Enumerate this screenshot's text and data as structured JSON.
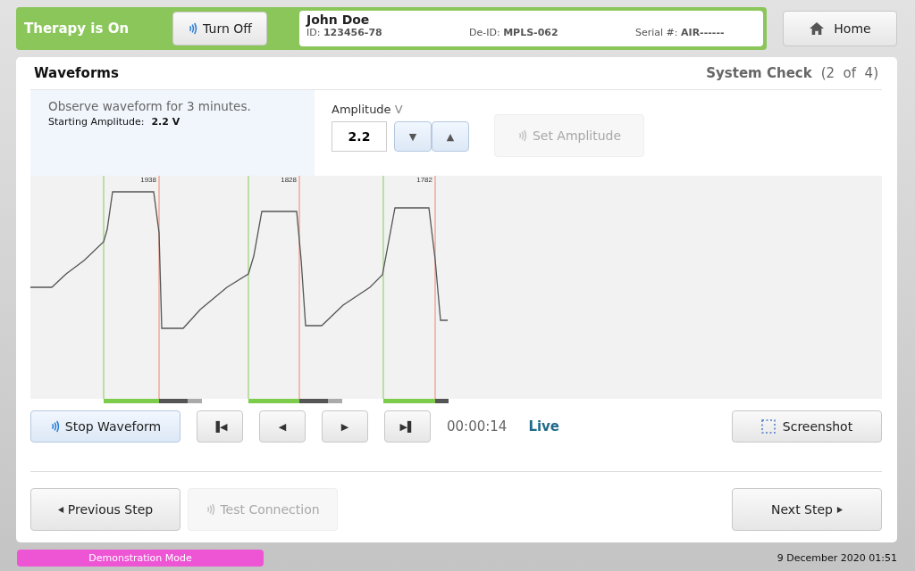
{
  "therapy": {
    "status": "Therapy is On",
    "button": "Turn Off"
  },
  "patient": {
    "name": "John Doe",
    "id_label": "ID:",
    "id": "123456-78",
    "deid_label": "De-ID:",
    "deid": "MPLS-062",
    "serial_label": "Serial #:",
    "serial": "AIR------"
  },
  "home_button": "Home",
  "panel": {
    "title": "Waveforms",
    "step_title": "System Check",
    "step_count": "(2  of  4)"
  },
  "instructions": {
    "text": "Observe waveform for 3 minutes.",
    "starting_label": "Starting Amplitude:",
    "starting_value": "2.2 V"
  },
  "amplitude": {
    "label": "Amplitude",
    "unit": "V",
    "value": "2.2",
    "down": "▼",
    "up": "▲",
    "set_button": "Set Amplitude",
    "set_disabled": true
  },
  "pulses": [
    {
      "label": "1938"
    },
    {
      "label": "1828"
    },
    {
      "label": "1782"
    }
  ],
  "controls": {
    "stop_button": "Stop Waveform",
    "first": "▐◀",
    "prev": "◀",
    "next": "▶",
    "last": "▶▌",
    "time": "00:00:14",
    "live": "Live",
    "screenshot": "Screenshot"
  },
  "steps": [
    {
      "kind": "prev",
      "label": "Previous Step",
      "disabled": false
    },
    {
      "kind": "test",
      "label": "Test Connection",
      "disabled": true
    },
    {
      "kind": "next",
      "label": "Next Step",
      "disabled": false
    }
  ],
  "footer": {
    "mode": "Demonstration Mode",
    "datetime": "9 December 2020 01:51"
  }
}
